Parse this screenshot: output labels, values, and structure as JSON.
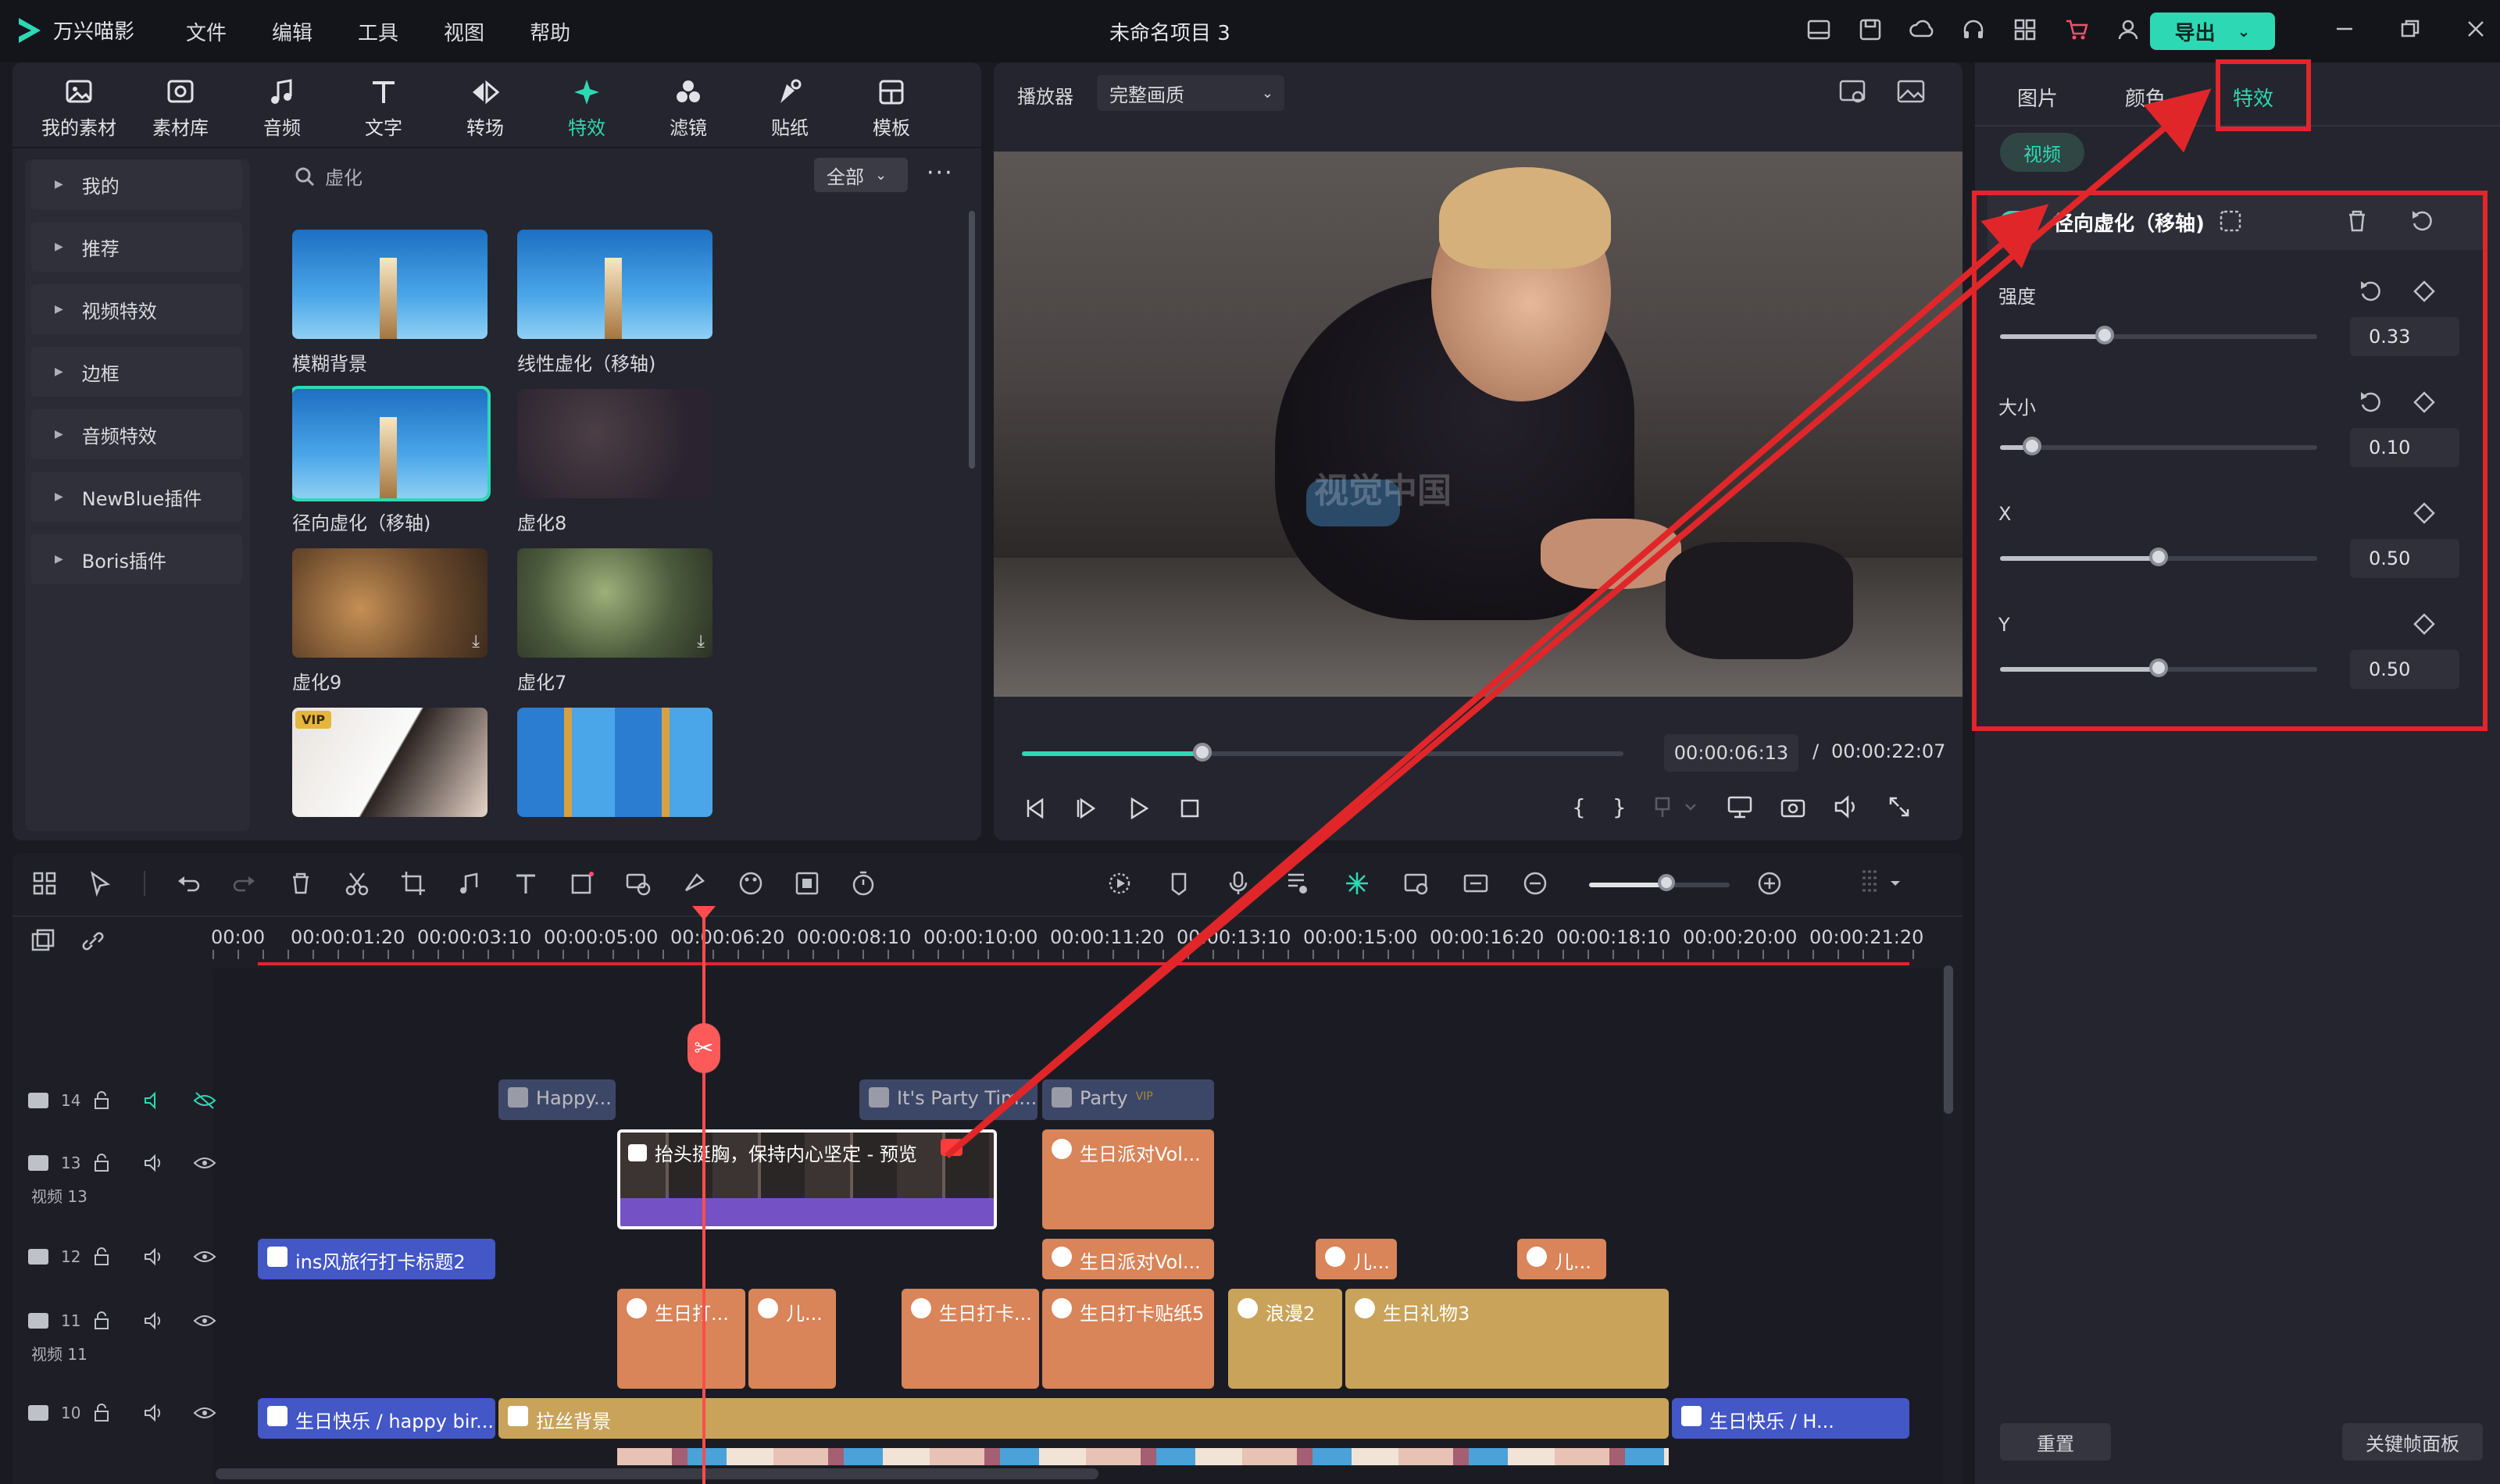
{
  "app": {
    "name": "万兴喵影",
    "project_title": "未命名项目 3",
    "export_label": "导出"
  },
  "menu": [
    "文件",
    "编辑",
    "工具",
    "视图",
    "帮助"
  ],
  "toolbar_tabs": [
    {
      "label": "我的素材",
      "icon": "folder-image-icon"
    },
    {
      "label": "素材库",
      "icon": "media-library-icon"
    },
    {
      "label": "音频",
      "icon": "music-note-icon"
    },
    {
      "label": "文字",
      "icon": "text-icon"
    },
    {
      "label": "转场",
      "icon": "transition-icon"
    },
    {
      "label": "特效",
      "icon": "sparkle-icon",
      "active": true
    },
    {
      "label": "滤镜",
      "icon": "filter-icon"
    },
    {
      "label": "贴纸",
      "icon": "sticker-icon"
    },
    {
      "label": "模板",
      "icon": "template-icon"
    }
  ],
  "categories": [
    "我的",
    "推荐",
    "视频特效",
    "边框",
    "音频特效",
    "NewBlue插件",
    "Boris插件"
  ],
  "search": {
    "placeholder": "虚化",
    "filter": "全部"
  },
  "effects": [
    {
      "label": "模糊背景"
    },
    {
      "label": "线性虚化（移轴)"
    },
    {
      "label": "径向虚化（移轴)",
      "selected": true
    },
    {
      "label": "虚化8"
    },
    {
      "label": "虚化9"
    },
    {
      "label": "虚化7"
    },
    {
      "label": "",
      "badge": "VIP"
    },
    {
      "label": ""
    }
  ],
  "player": {
    "label": "播放器",
    "quality": "完整画质",
    "current_time": "00:00:06:13",
    "separator": "/",
    "total_time": "00:00:22:07",
    "watermark": "视觉中国",
    "progress": 0.3
  },
  "inspector": {
    "tabs": [
      "图片",
      "颜色",
      "特效"
    ],
    "active_tab": "特效",
    "sub_tab": "视频",
    "effect_name": "径向虚化（移轴)",
    "params": [
      {
        "label": "强度",
        "value": "0.33",
        "fraction": 0.33
      },
      {
        "label": "大小",
        "value": "0.10",
        "fraction": 0.1
      },
      {
        "label": "X",
        "value": "0.50",
        "fraction": 0.5
      },
      {
        "label": "Y",
        "value": "0.50",
        "fraction": 0.5
      }
    ],
    "reset_label": "重置",
    "keyframe_label": "关键帧面板"
  },
  "timeline": {
    "ruler": [
      "00:00",
      "00:00:01:20",
      "00:00:03:10",
      "00:00:05:00",
      "00:00:06:20",
      "00:00:08:10",
      "00:00:10:00",
      "00:00:11:20",
      "00:00:13:10",
      "00:00:15:00",
      "00:00:16:20",
      "00:00:18:10",
      "00:00:20:00",
      "00:00:21:20"
    ],
    "tracks": [
      {
        "num": "14",
        "sub": ""
      },
      {
        "num": "13",
        "sub": "视频 13"
      },
      {
        "num": "12",
        "sub": ""
      },
      {
        "num": "11",
        "sub": "视频 11"
      },
      {
        "num": "10",
        "sub": ""
      }
    ],
    "clips": {
      "t14": [
        "Happy...",
        "It's Party Tim...",
        "Party"
      ],
      "t14_badge": "VIP",
      "t13": [
        "抬头挺胸，保持内心坚定 - 预览",
        "生日派对Vol..."
      ],
      "t12": [
        "ins风旅行打卡标题2",
        "生日派对Vol...",
        "儿...",
        "儿..."
      ],
      "t11": [
        "生日打...",
        "儿...",
        "生日打卡...",
        "生日打卡贴纸5",
        "浪漫2",
        "生日礼物3"
      ],
      "t10": [
        "生日快乐 / happy bir...",
        "拉丝背景",
        "生日快乐 / H..."
      ]
    }
  },
  "colors": {
    "accent": "#2dd9b4",
    "highlight": "#e1262a",
    "clip_blue": "#4357c6",
    "clip_orange": "#d98459",
    "clip_gold": "#c9a35a"
  }
}
